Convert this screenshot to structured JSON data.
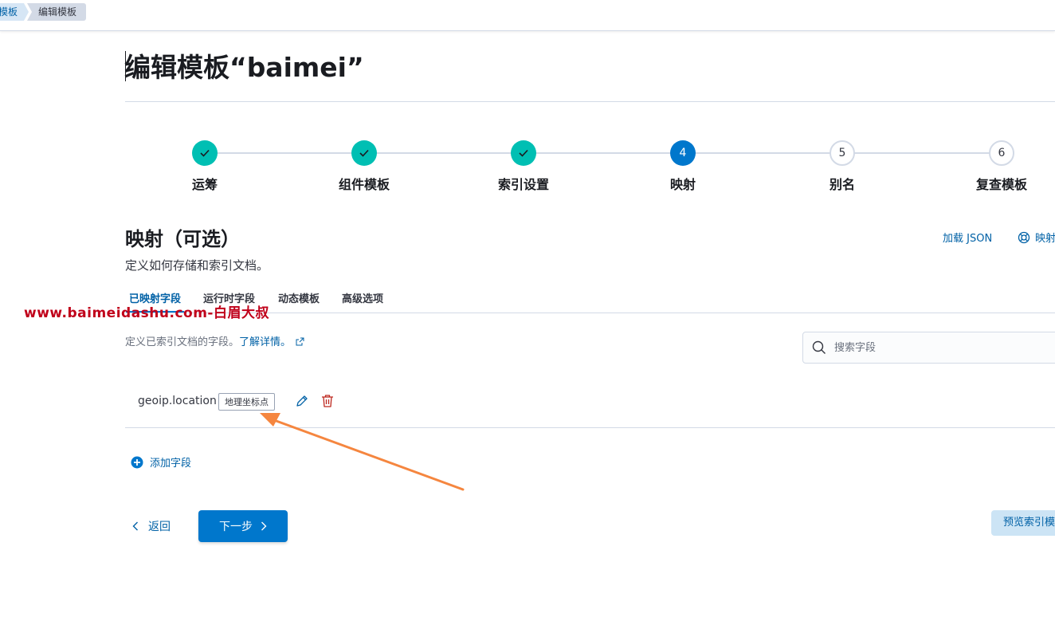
{
  "breadcrumbs": [
    "模板",
    "编辑模板"
  ],
  "page_title": "编辑模板“baimei”",
  "steps": [
    {
      "number": "1",
      "label": "运筹",
      "status": "done"
    },
    {
      "number": "2",
      "label": "组件模板",
      "status": "done"
    },
    {
      "number": "3",
      "label": "索引设置",
      "status": "done"
    },
    {
      "number": "4",
      "label": "映射",
      "status": "current"
    },
    {
      "number": "5",
      "label": "别名",
      "status": "todo"
    },
    {
      "number": "6",
      "label": "复查模板",
      "status": "todo"
    }
  ],
  "section": {
    "title": "映射（可选）",
    "description": "定义如何存储和索引文档。",
    "load_json_label": "加载 JSON",
    "help_link_label": "映射"
  },
  "tabs": [
    {
      "label": "已映射字段",
      "active": true
    },
    {
      "label": "运行时字段",
      "active": false
    },
    {
      "label": "动态模板",
      "active": false
    },
    {
      "label": "高级选项",
      "active": false
    }
  ],
  "watermark": "www.baimeidashu.com-白眉大叔",
  "fields_panel": {
    "description": "定义已索引文档的字段。",
    "learn_more": "了解详情。",
    "search_placeholder": "搜索字段"
  },
  "fields": [
    {
      "name": "geoip.location",
      "type": "地理坐标点"
    }
  ],
  "add_field_label": "添加字段",
  "footer": {
    "back_label": "返回",
    "next_label": "下一步",
    "preview_label": "预览索引模板"
  },
  "colors": {
    "primary": "#0077cc",
    "link": "#0061a6",
    "step_done": "#00bfb3",
    "delete": "#bd271e",
    "annotation_arrow": "#f5863f",
    "watermark": "#c0001a"
  }
}
